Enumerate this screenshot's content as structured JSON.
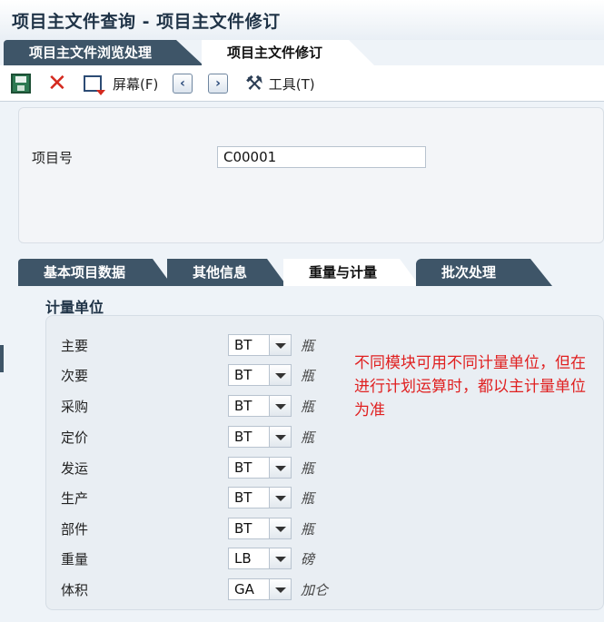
{
  "window": {
    "title": "项目主文件查询 - 项目主文件修订"
  },
  "app_tabs": [
    {
      "label": "项目主文件浏览处理",
      "active": false
    },
    {
      "label": "项目主文件修订",
      "active": true
    }
  ],
  "toolbar": {
    "save_icon": "save-icon",
    "cancel_icon": "close-icon",
    "screen_label": "屏幕(F)",
    "prev_icon": "chevron-left-icon",
    "next_icon": "chevron-right-icon",
    "tools_label": "工具(T)"
  },
  "header": {
    "item_no_label": "项目号",
    "item_no_value": "C00001"
  },
  "sub_tabs": [
    {
      "label": "基本项目数据",
      "active": false
    },
    {
      "label": "其他信息",
      "active": false
    },
    {
      "label": "重量与计量",
      "active": true
    },
    {
      "label": "批次处理",
      "active": false
    }
  ],
  "uom": {
    "section_title": "计量单位",
    "rows": [
      {
        "label": "主要",
        "value": "BT",
        "desc": "瓶"
      },
      {
        "label": "次要",
        "value": "BT",
        "desc": "瓶"
      },
      {
        "label": "采购",
        "value": "BT",
        "desc": "瓶"
      },
      {
        "label": "定价",
        "value": "BT",
        "desc": "瓶"
      },
      {
        "label": "发运",
        "value": "BT",
        "desc": "瓶"
      },
      {
        "label": "生产",
        "value": "BT",
        "desc": "瓶"
      },
      {
        "label": "部件",
        "value": "BT",
        "desc": "瓶"
      },
      {
        "label": "重量",
        "value": "LB",
        "desc": "磅"
      },
      {
        "label": "体积",
        "value": "GA",
        "desc": "加仑"
      }
    ]
  },
  "annotation": {
    "text": "不同模块可用不同计量单位，但在进行计划运算时，都以主计量单位为准",
    "color": "#e02020"
  },
  "colors": {
    "tab_dark": "#3e5568",
    "title": "#1f3347"
  }
}
